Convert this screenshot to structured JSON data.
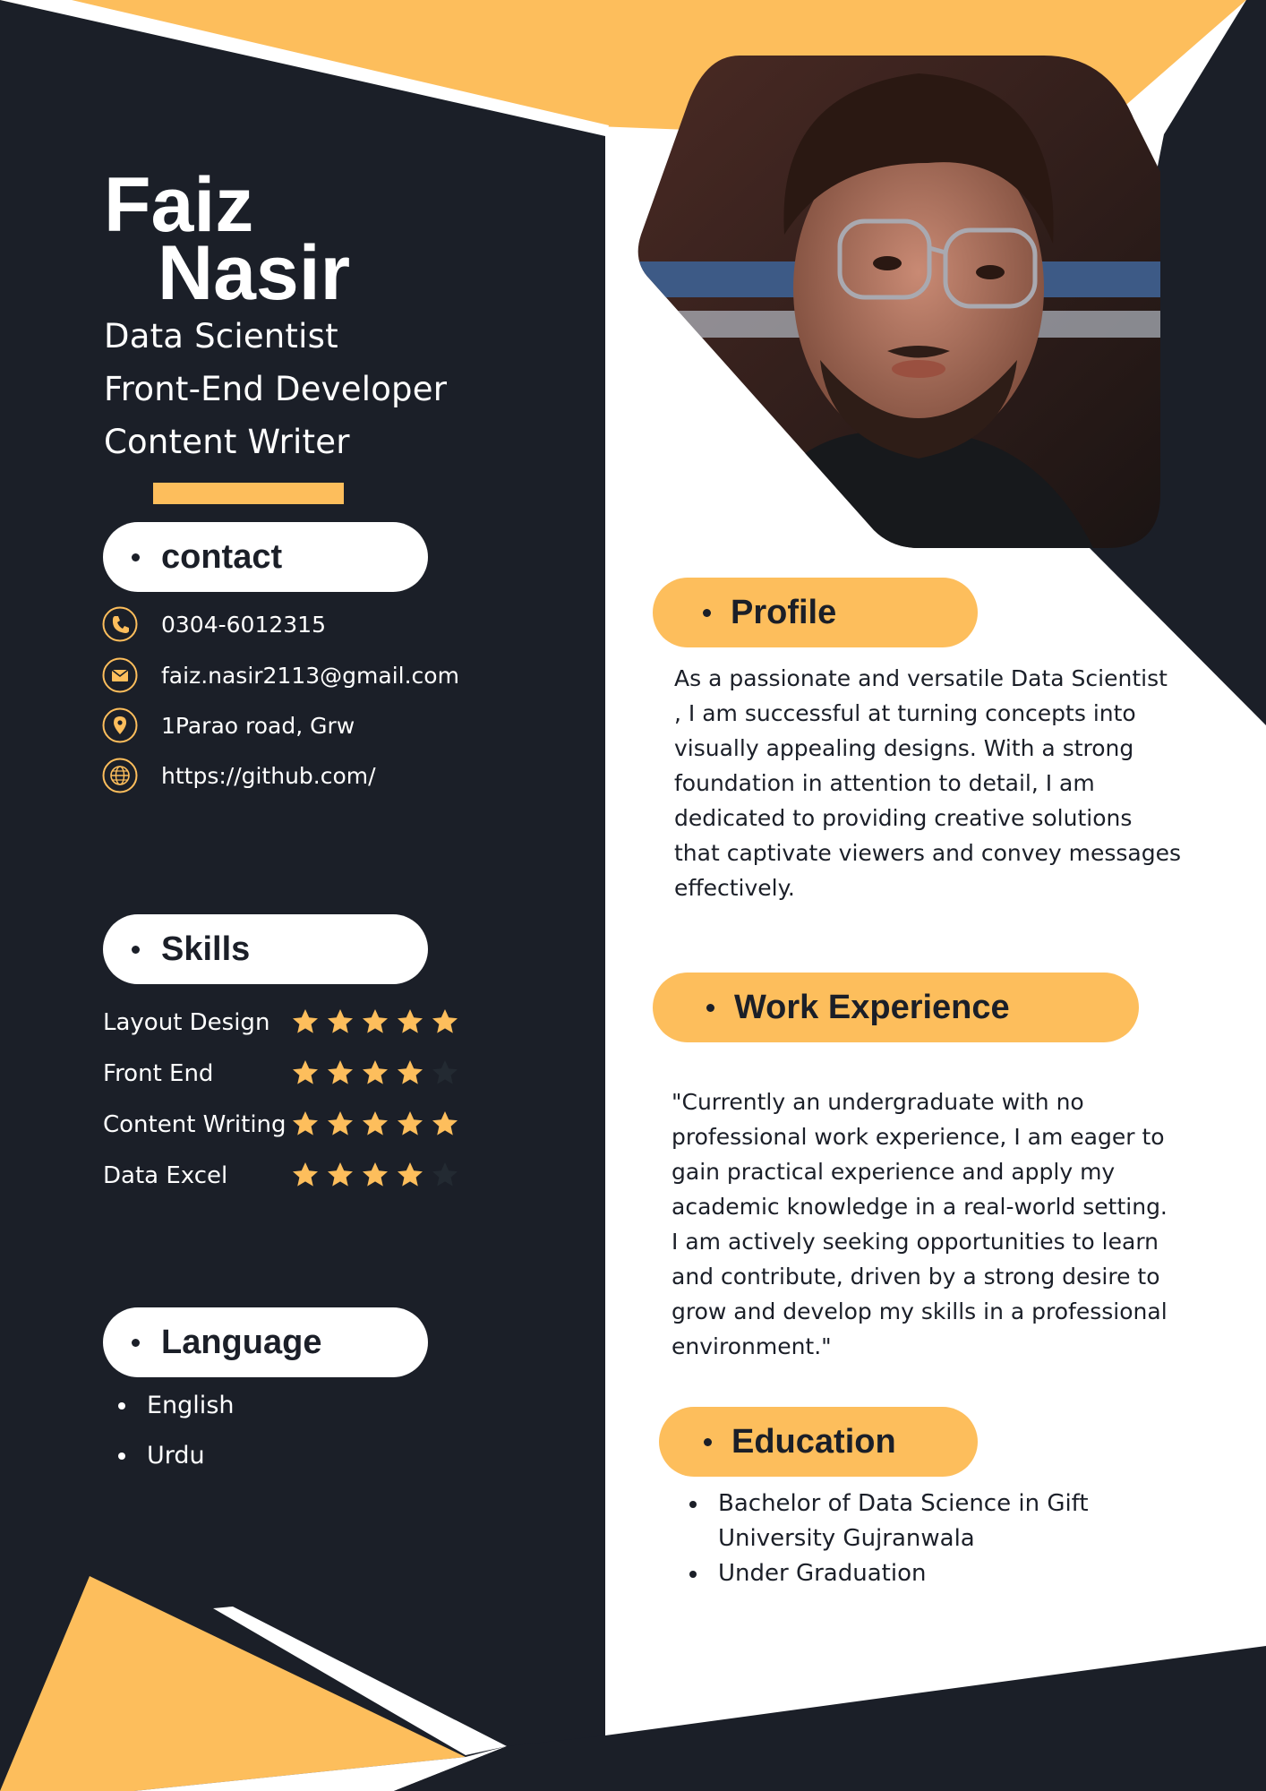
{
  "colors": {
    "dark": "#1B1F28",
    "accent": "#FDBE5C",
    "white": "#ffffff"
  },
  "header": {
    "first_name": "Faiz",
    "last_name": "Nasir",
    "roles": [
      "Data Scientist",
      "Front-End Developer",
      "Content Writer"
    ]
  },
  "photo": {
    "icon": "profile-photo"
  },
  "contact": {
    "heading": "contact",
    "items": [
      {
        "icon": "phone-icon",
        "text": "0304-6012315"
      },
      {
        "icon": "mail-icon",
        "text": "faiz.nasir2113@gmail.com"
      },
      {
        "icon": "location-pin-icon",
        "text": "1Parao road, Grw"
      },
      {
        "icon": "globe-icon",
        "text": "https://github.com/"
      }
    ]
  },
  "skills": {
    "heading": "Skills",
    "max_rating": 5,
    "items": [
      {
        "label": "Layout Design",
        "rating": 5
      },
      {
        "label": "Front End",
        "rating": 4
      },
      {
        "label": "Content Writing",
        "rating": 5
      },
      {
        "label": "Data Excel",
        "rating": 4
      }
    ]
  },
  "language": {
    "heading": "Language",
    "items": [
      "English",
      "Urdu"
    ]
  },
  "profile": {
    "heading": "Profile",
    "lines": [
      "As a passionate and versatile Data Scientist",
      ", I am successful at turning concepts into",
      "visually appealing designs. With a strong",
      "foundation in attention to detail, I am",
      "dedicated to providing creative solutions",
      "that captivate viewers and convey messages",
      "effectively."
    ]
  },
  "work": {
    "heading": "Work Experience",
    "lines": [
      "\"Currently an undergraduate with no",
      "professional work experience, I am eager to",
      "gain practical experience and apply my",
      "academic knowledge in a real-world setting.",
      "I am actively seeking opportunities to learn",
      "and contribute, driven by a strong desire to",
      "grow and develop my skills in a professional",
      "environment.\""
    ]
  },
  "education": {
    "heading": "Education",
    "items": [
      [
        "Bachelor of Data Science in Gift",
        "University Gujranwala"
      ],
      [
        "Under Graduation"
      ]
    ]
  }
}
